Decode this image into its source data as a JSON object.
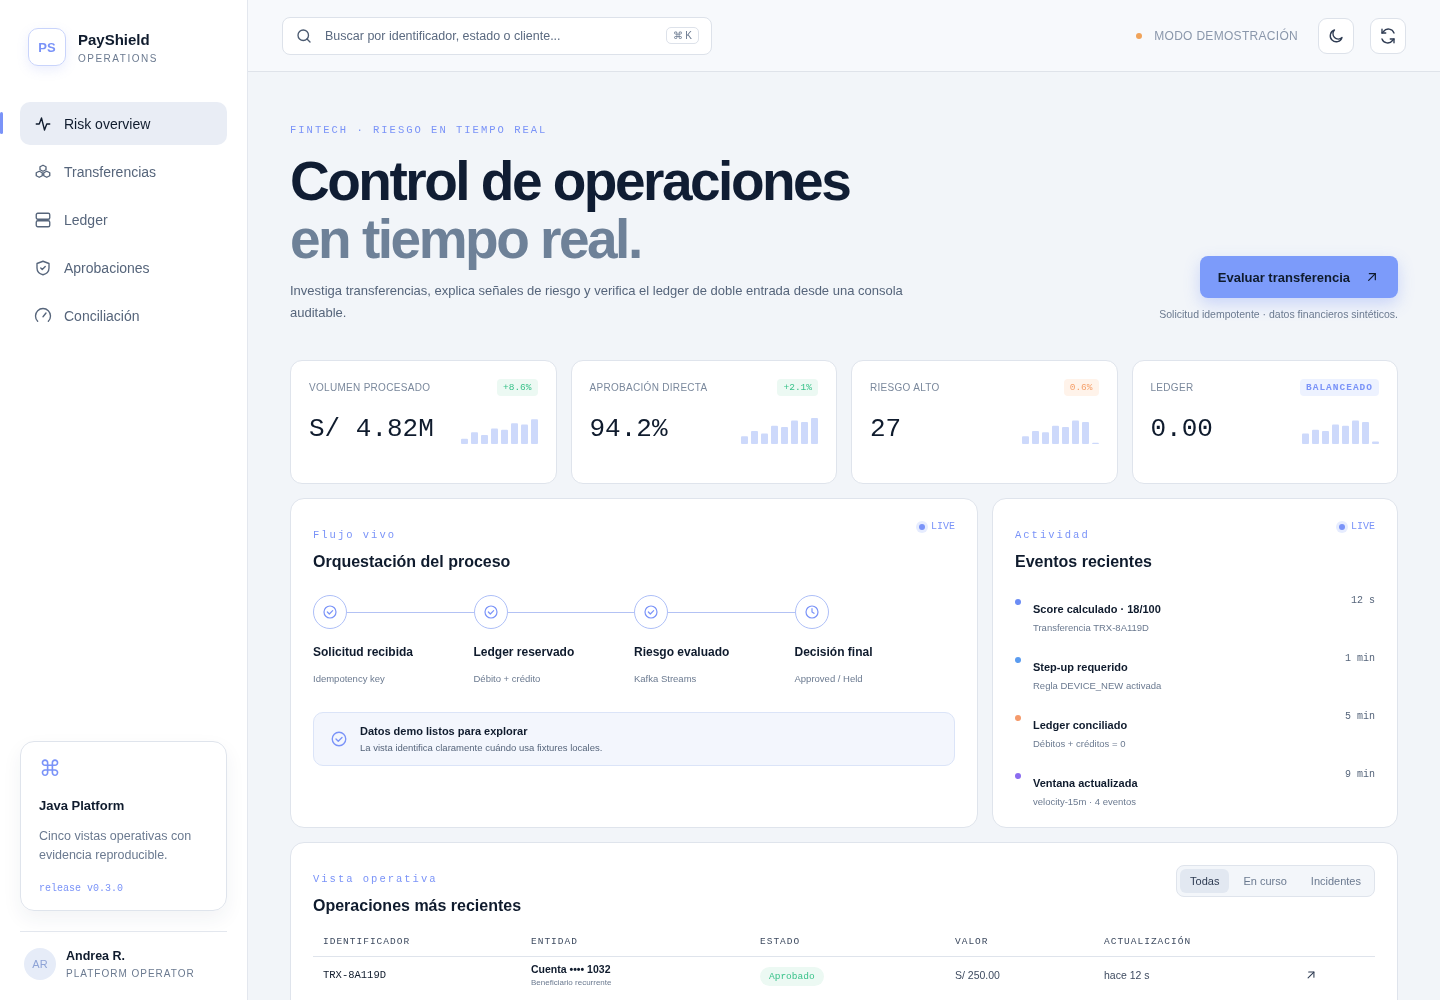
{
  "brand": {
    "initials": "PS",
    "name": "PayShield",
    "subtitle": "OPERATIONS"
  },
  "sidebar": {
    "items": [
      {
        "label": "Risk overview",
        "selected": true
      },
      {
        "label": "Transferencias",
        "selected": false
      },
      {
        "label": "Ledger",
        "selected": false
      },
      {
        "label": "Aprobaciones",
        "selected": false
      },
      {
        "label": "Conciliación",
        "selected": false
      }
    ],
    "card": {
      "symbol": "⌘",
      "title": "Java Platform",
      "text": "Cinco vistas operativas con evidencia reproducible.",
      "release": "release v0.3.0"
    },
    "user": {
      "initials": "AR",
      "name": "Andrea R.",
      "role": "PLATFORM OPERATOR"
    }
  },
  "header": {
    "search": {
      "placeholder": "Buscar por identificador, estado o cliente...",
      "shortcut": "⌘ K"
    },
    "mode": "MODO DEMOSTRACIÓN"
  },
  "hero": {
    "eyebrow": "FINTECH · RIESGO EN TIEMPO REAL",
    "title_line1": "Control de operaciones",
    "title_line2": "en tiempo real.",
    "description": "Investiga transferencias, explica señales de riesgo y verifica el ledger de doble entrada desde una consola auditable.",
    "button": "Evaluar transferencia",
    "note": "Solicitud idempotente · datos financieros sintéticos."
  },
  "kpis": [
    {
      "label": "VOLUMEN PROCESADO",
      "badge": "+8.6%",
      "kind": "positive",
      "value": "S/ 4.82M"
    },
    {
      "label": "APROBACIÓN DIRECTA",
      "badge": "+2.1%",
      "kind": "positive",
      "value": "94.2%"
    },
    {
      "label": "RIESGO ALTO",
      "badge": "0.6%",
      "kind": "warning",
      "value": "27"
    },
    {
      "label": "LEDGER",
      "badge": "BALANCEADO",
      "kind": "info",
      "value": "0.00"
    }
  ],
  "flow": {
    "eyebrow": "Flujo vivo",
    "title": "Orquestación del proceso",
    "live": "LIVE",
    "steps": [
      {
        "title": "Solicitud recibida",
        "detail": "Idempotency key",
        "done": true
      },
      {
        "title": "Ledger reservado",
        "detail": "Débito + crédito",
        "done": true
      },
      {
        "title": "Riesgo evaluado",
        "detail": "Kafka Streams",
        "done": true
      },
      {
        "title": "Decisión final",
        "detail": "Approved / Held",
        "done": false
      }
    ],
    "notice": {
      "title": "Datos demo listos para explorar",
      "text": "La vista identifica claramente cuándo usa fixtures locales."
    }
  },
  "activity": {
    "eyebrow": "Actividad",
    "title": "Eventos recientes",
    "live": "LIVE",
    "events": [
      {
        "title": "Score calculado · 18/100",
        "detail": "Transferencia TRX-8A119D",
        "time": "12 s",
        "color": "#6b8cf5"
      },
      {
        "title": "Step-up requerido",
        "detail": "Regla DEVICE_NEW activada",
        "time": "1 min",
        "color": "#5b9cf0"
      },
      {
        "title": "Ledger conciliado",
        "detail": "Débitos + créditos = 0",
        "time": "5 min",
        "color": "#f59a6b"
      },
      {
        "title": "Ventana actualizada",
        "detail": "velocity-15m · 4 eventos",
        "time": "9 min",
        "color": "#8b6cf0"
      }
    ]
  },
  "operations": {
    "eyebrow": "Vista operativa",
    "title": "Operaciones más recientes",
    "filters": [
      {
        "label": "Todas",
        "selected": true
      },
      {
        "label": "En curso",
        "selected": false
      },
      {
        "label": "Incidentes",
        "selected": false
      }
    ],
    "columns": [
      "IDENTIFICADOR",
      "ENTIDAD",
      "ESTADO",
      "VALOR",
      "ACTUALIZACIÓN"
    ],
    "rows": [
      {
        "id": "TRX-8A119D",
        "entity": "Cuenta •••• 1032",
        "entity_detail": "Beneficiario recurrente",
        "status": "Aprobado",
        "kind": "positive",
        "value": "S/ 250.00",
        "updated": "hace 12 s"
      }
    ]
  }
}
